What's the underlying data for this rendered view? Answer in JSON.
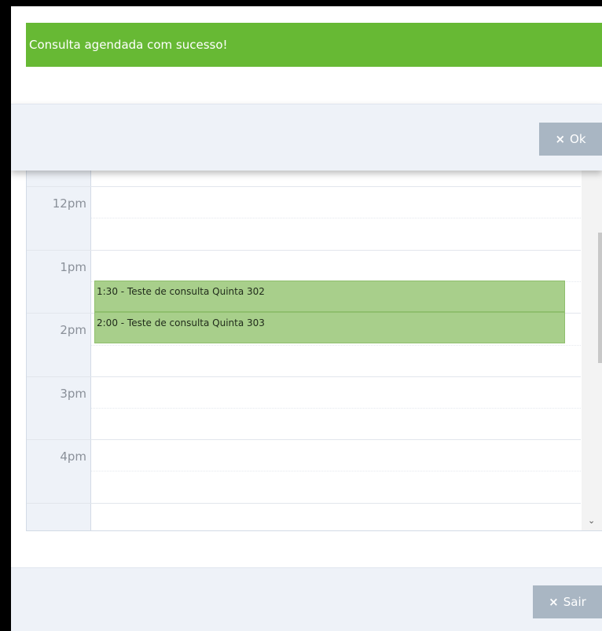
{
  "alert": {
    "message": "Consulta agendada com sucesso!"
  },
  "ok_dialog": {
    "ok_icon": "×",
    "ok_label": "Ok"
  },
  "calendar": {
    "hours": [
      "12pm",
      "1pm",
      "2pm",
      "3pm",
      "4pm"
    ],
    "events": [
      {
        "time": "1:30",
        "text": "1:30 - Teste de consulta Quinta 302"
      },
      {
        "time": "2:00",
        "text": "2:00 - Teste de consulta Quinta 303"
      }
    ],
    "scroll_down_icon": "⌄"
  },
  "footer": {
    "sair_icon": "×",
    "sair_label": "Sair"
  },
  "colors": {
    "success": "#67b934",
    "event": "#a8cf8b",
    "button": "#a9b6c3",
    "footer": "#eef2f8"
  }
}
